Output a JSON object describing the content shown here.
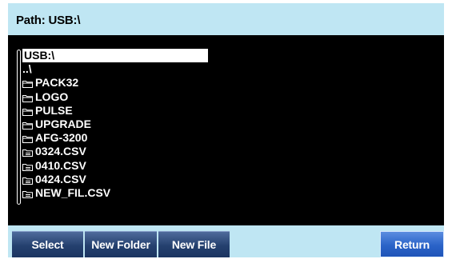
{
  "header": {
    "path_label": "Path: USB:\\"
  },
  "files": [
    {
      "name": "USB:\\",
      "icon": "none",
      "selected": true
    },
    {
      "name": "..\\",
      "icon": "none",
      "selected": false
    },
    {
      "name": "PACK32",
      "icon": "folder-icon",
      "selected": false
    },
    {
      "name": "LOGO",
      "icon": "folder-icon",
      "selected": false
    },
    {
      "name": "PULSE",
      "icon": "folder-icon",
      "selected": false
    },
    {
      "name": "UPGRADE",
      "icon": "folder-icon",
      "selected": false
    },
    {
      "name": "AFG-3200",
      "icon": "folder-icon",
      "selected": false
    },
    {
      "name": "0324.CSV",
      "icon": "file-icon",
      "selected": false
    },
    {
      "name": "0410.CSV",
      "icon": "file-icon",
      "selected": false
    },
    {
      "name": "0424.CSV",
      "icon": "file-icon",
      "selected": false
    },
    {
      "name": "NEW_FIL.CSV",
      "icon": "file-icon",
      "selected": false
    }
  ],
  "softkeys": {
    "select": "Select",
    "new_folder": "New Folder",
    "new_file": "New File",
    "return": "Return"
  },
  "colors": {
    "frame": "#bfe6f3",
    "panel": "#000000",
    "softkey": "#24406e",
    "softkey_active": "#2a63c8"
  }
}
